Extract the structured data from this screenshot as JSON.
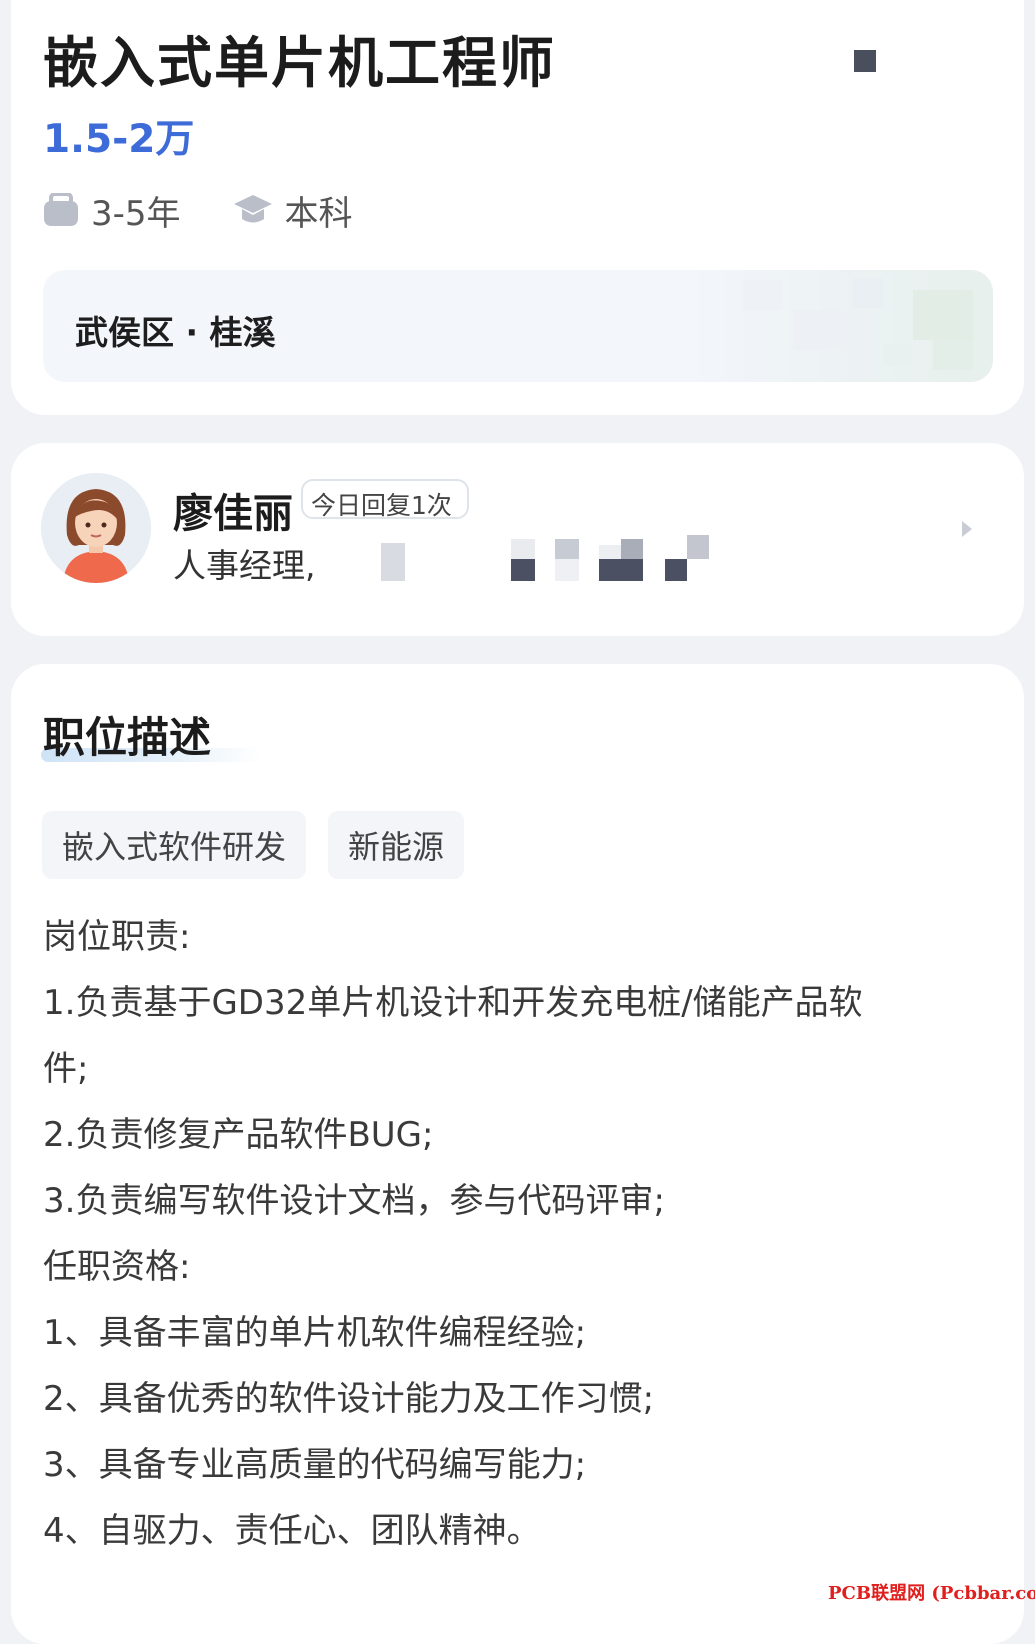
{
  "job": {
    "title": "嵌入式单片机工程师",
    "salary": "1.5-2万",
    "experience": "3-5年",
    "education": "本科",
    "location": "武侯区 · 桂溪",
    "experience_icon": "briefcase-icon",
    "education_icon": "graduation-cap-icon"
  },
  "recruiter": {
    "name": "廖佳丽",
    "reply_badge": "今日回复1次",
    "role": "人事经理,",
    "avatar_icon": "avatar-illustration"
  },
  "description": {
    "section_title": "职位描述",
    "tags": [
      "嵌入式软件研发",
      "新能源"
    ],
    "lines": [
      "岗位职责:",
      "1.负责基于GD32单片机设计和开发充电桩/储能产品软",
      "件;",
      "2.负责修复产品软件BUG;",
      "3.负责编写软件设计文档，参与代码评审;",
      "任职资格:",
      "1、具备丰富的单片机软件编程经验;",
      "2、具备优秀的软件设计能力及工作习惯;",
      "3、具备专业高质量的代码编写能力;",
      "4、自驱力、责任心、团队精神。"
    ]
  },
  "watermark": "PCB联盟网 (Pcbbar.com)",
  "colors": {
    "salary": "#3d6bd8",
    "background": "#f0f2f6",
    "card": "#ffffff",
    "watermark": "#e0201e"
  }
}
